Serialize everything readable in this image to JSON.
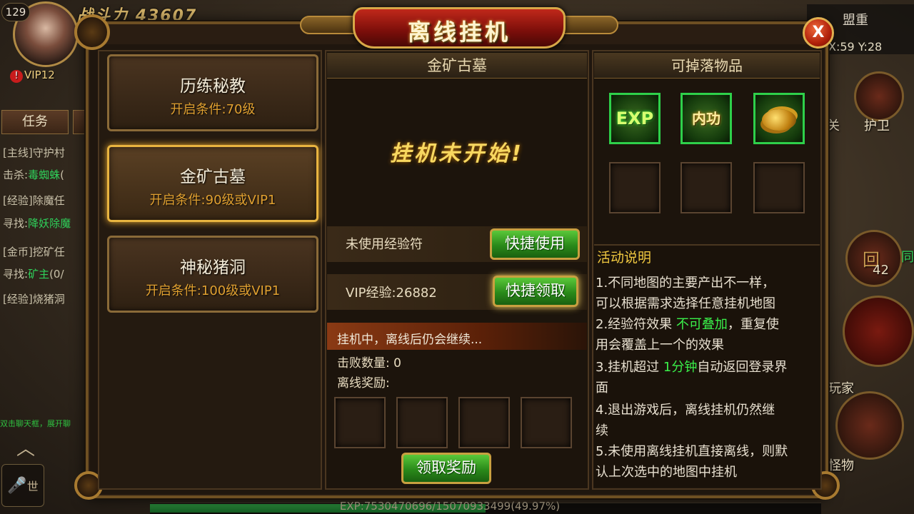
{
  "hud": {
    "level": "129",
    "power_label": "战斗力",
    "power_value": "43607",
    "vip": "VIP12",
    "tab_task": "任务",
    "quests": [
      {
        "tag": "[主线]",
        "text": "守护村"
      },
      {
        "prefix": "击杀:",
        "target": "毒蜘蛛",
        "rest": "("
      },
      {
        "tag": "[经验]",
        "text": "除魔任"
      },
      {
        "prefix": "寻找:",
        "target": "降妖除魔",
        "rest": ""
      },
      {
        "tag": "[金币]",
        "text": "挖矿任"
      },
      {
        "prefix": "寻找:",
        "target": "矿主",
        "rest": "(0/"
      },
      {
        "tag": "[经验]",
        "text": "烧猪洞"
      }
    ],
    "scroll_text": "双击聊天框，展开聊",
    "mic_label": "世",
    "guild": "盟重",
    "coords": "X:59 Y:28",
    "right_guard": "护卫",
    "right_pass": "关",
    "right_return": "回",
    "right_count": "42",
    "right_players": "玩家",
    "right_monster": "怪物",
    "right_tong": "同",
    "exp_text": "EXP:7530470696/15070933499(49.97%)",
    "exp_progress": 0.4997
  },
  "dialog": {
    "title": "离线挂机",
    "close_label": "X",
    "maps": [
      {
        "name": "历练秘教",
        "condition": "开启条件:70级",
        "selected": false
      },
      {
        "name": "金矿古墓",
        "condition": "开启条件:90级或VIP1",
        "selected": true
      },
      {
        "name": "神秘猪洞",
        "condition": "开启条件:100级或VIP1",
        "selected": false
      }
    ],
    "middle": {
      "header": "金矿古墓",
      "status": "挂机未开始!",
      "exp_scroll_label": "未使用经验符",
      "exp_scroll_button": "快捷使用",
      "vip_exp_label": "VIP经验:26882",
      "vip_exp_button": "快捷领取",
      "running_text": "挂机中，离线后仍会继续...",
      "kills_label": "击败数量: 0",
      "reward_label": "离线奖励:",
      "claim_button": "领取奖励"
    },
    "right": {
      "header": "可掉落物品",
      "drops": [
        {
          "icon": "exp-icon",
          "label": "EXP"
        },
        {
          "icon": "neigong-icon",
          "label": "内功"
        },
        {
          "icon": "gold-coins-icon",
          "label": ""
        }
      ],
      "desc_title": "活动说明",
      "desc": {
        "l1": "1.不同地图的主要产出不一样，",
        "l2": "可以根据需求选择任意挂机地图",
        "l3a": "2.经验符效果",
        "l3hl": "不可叠加",
        "l3b": "，重复使",
        "l4": "用会覆盖上一个的效果",
        "l5a": "3.挂机超过",
        "l5hl": "1分钟",
        "l5b": "自动返回登录界",
        "l6": "面",
        "l7": "4.退出游戏后，离线挂机仍然继",
        "l8": "续",
        "l9": "5.未使用离线挂机直接离线，则默",
        "l10": "认上次选中的地图中挂机"
      }
    }
  }
}
